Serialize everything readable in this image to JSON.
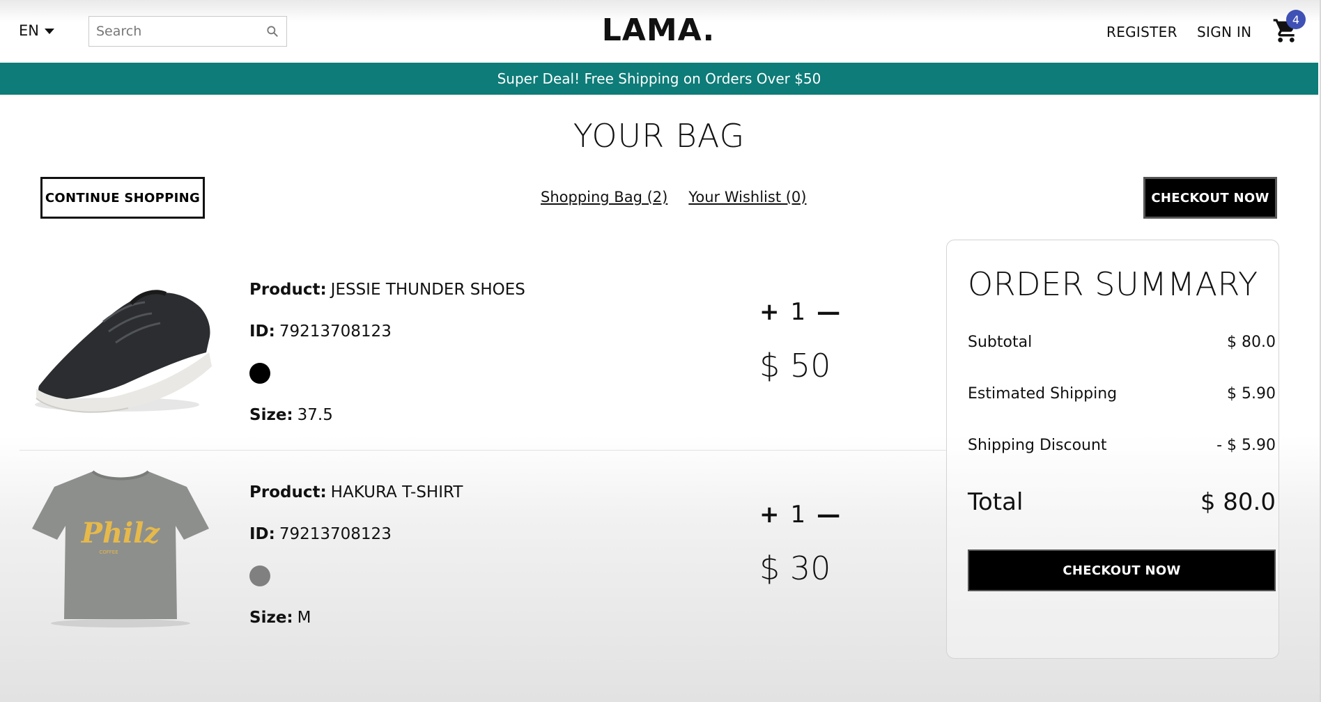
{
  "nav": {
    "language": "EN",
    "search_placeholder": "Search",
    "logo": "LAMA.",
    "register": "REGISTER",
    "sign_in": "SIGN IN",
    "cart_count": "4"
  },
  "announcement": "Super Deal! Free Shipping on Orders Over $50",
  "page_title": "YOUR BAG",
  "top": {
    "continue_label": "CONTINUE SHOPPING",
    "bag_link": "Shopping Bag (2)",
    "wishlist_link": "Your Wishlist (0)",
    "checkout_label": "CHECKOUT NOW"
  },
  "labels": {
    "product": "Product:",
    "id": "ID:",
    "size": "Size:"
  },
  "products": [
    {
      "name": "JESSIE THUNDER SHOES",
      "id": "79213708123",
      "color": "#000000",
      "size": "37.5",
      "quantity": "1",
      "price": "$ 50",
      "image_icon": "sneaker-image"
    },
    {
      "name": "HAKURA T-SHIRT",
      "id": "79213708123",
      "color": "#808080",
      "size": "M",
      "quantity": "1",
      "price": "$ 30",
      "image_icon": "tshirt-image",
      "print_text": "Philz"
    }
  ],
  "summary": {
    "title": "ORDER SUMMARY",
    "subtotal_label": "Subtotal",
    "subtotal_value": "$ 80.0",
    "shipping_label": "Estimated Shipping",
    "shipping_value": "$ 5.90",
    "discount_label": "Shipping Discount",
    "discount_value": "- $ 5.90",
    "total_label": "Total",
    "total_value": "$ 80.0",
    "checkout_label": "CHECKOUT NOW"
  },
  "colors": {
    "announcement_bg": "#0e7c78",
    "badge": "#3f51b5",
    "button_dark": "#000000"
  }
}
